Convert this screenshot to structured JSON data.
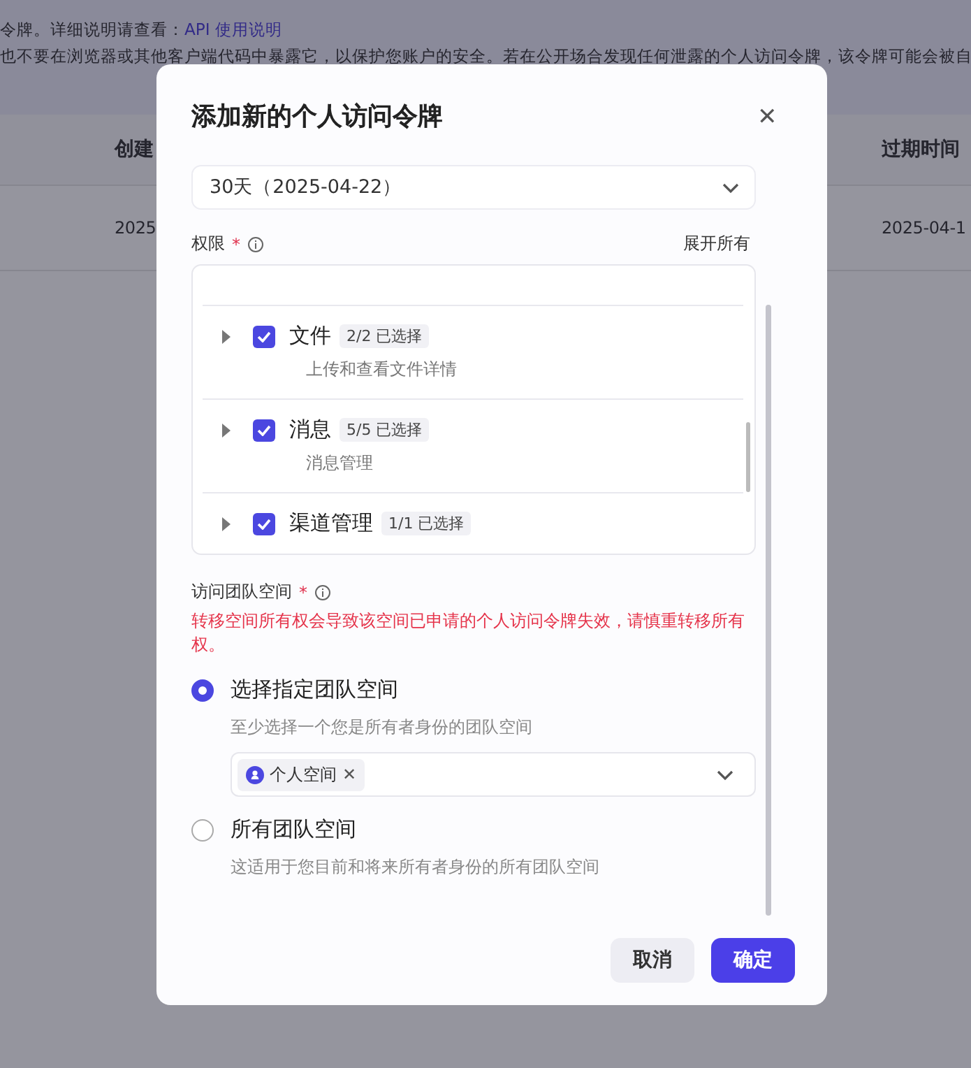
{
  "page": {
    "notice_intro": "令牌。详细说明请查看：",
    "notice_link": "API 使用说明",
    "notice_warning": "也不要在浏览器或其他客户端代码中暴露它，以保护您账户的安全。若在公开场合发现任何泄露的个人访问令牌，该令牌可能会被自"
  },
  "table": {
    "columns": [
      "创建",
      "过期时间"
    ],
    "rows": [
      [
        "2025",
        "2025-04-1"
      ]
    ]
  },
  "dialog": {
    "title": "添加新的个人访问令牌",
    "close": "✕",
    "expiry": {
      "value": "30天（2025-04-22）"
    },
    "permissions": {
      "label": "权限",
      "required_mark": "*",
      "expand_all": "展开所有",
      "items": [
        {
          "name": "文件",
          "count": "2/2 已选择",
          "description": "上传和查看文件详情",
          "checked": true
        },
        {
          "name": "消息",
          "count": "5/5 已选择",
          "description": "消息管理",
          "checked": true
        },
        {
          "name": "渠道管理",
          "count": "1/1 已选择",
          "checked": true
        }
      ]
    },
    "team_space": {
      "label": "访问团队空间",
      "required_mark": "*",
      "warning": "转移空间所有权会导致该空间已申请的个人访问令牌失效，请慎重转移所有权。",
      "options": [
        {
          "label": "选择指定团队空间",
          "description": "至少选择一个您是所有者身份的团队空间",
          "selected": true,
          "tags": [
            {
              "label": "个人空间",
              "remove": "✕"
            }
          ]
        },
        {
          "label": "所有团队空间",
          "description": "这适用于您目前和将来所有者身份的所有团队空间",
          "selected": false
        }
      ]
    },
    "buttons": [
      {
        "label": "取消",
        "kind": "secondary"
      },
      {
        "label": "确定",
        "kind": "primary"
      }
    ]
  }
}
